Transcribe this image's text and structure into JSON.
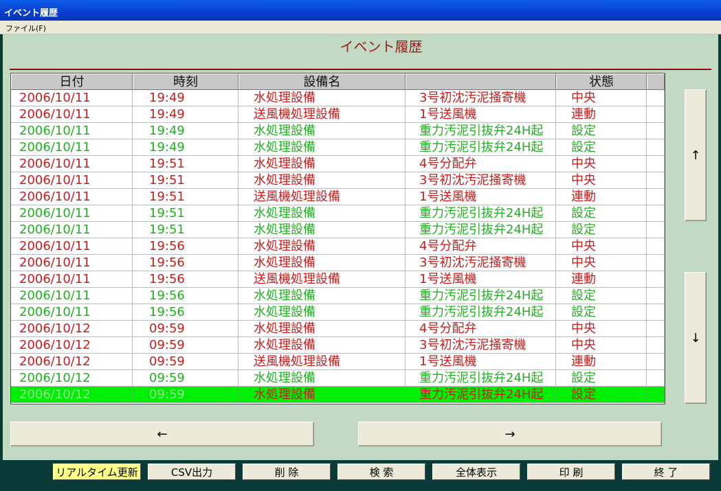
{
  "window": {
    "title": "イベント履歴"
  },
  "menu": {
    "file": "ファイル(F)"
  },
  "heading": "イベント履歴",
  "table": {
    "columns": [
      "日付",
      "時刻",
      "設備名",
      "",
      "状態",
      ""
    ],
    "rows": [
      {
        "date": "2006/10/11",
        "time": "19:49",
        "equip": "水処理設備",
        "point": "3号初沈汚泥掻寄機",
        "state": "中央",
        "color": "red"
      },
      {
        "date": "2006/10/11",
        "time": "19:49",
        "equip": "送風機処理設備",
        "point": "1号送風機",
        "state": "連動",
        "color": "red"
      },
      {
        "date": "2006/10/11",
        "time": "19:49",
        "equip": "水処理設備",
        "point": "重力汚泥引抜弁24H起",
        "state": "設定",
        "color": "green"
      },
      {
        "date": "2006/10/11",
        "time": "19:49",
        "equip": "水処理設備",
        "point": "重力汚泥引抜弁24H起",
        "state": "設定",
        "color": "green"
      },
      {
        "date": "2006/10/11",
        "time": "19:51",
        "equip": "水処理設備",
        "point": "4号分配弁",
        "state": "中央",
        "color": "red"
      },
      {
        "date": "2006/10/11",
        "time": "19:51",
        "equip": "水処理設備",
        "point": "3号初沈汚泥掻寄機",
        "state": "中央",
        "color": "red"
      },
      {
        "date": "2006/10/11",
        "time": "19:51",
        "equip": "送風機処理設備",
        "point": "1号送風機",
        "state": "連動",
        "color": "red"
      },
      {
        "date": "2006/10/11",
        "time": "19:51",
        "equip": "水処理設備",
        "point": "重力汚泥引抜弁24H起",
        "state": "設定",
        "color": "green"
      },
      {
        "date": "2006/10/11",
        "time": "19:51",
        "equip": "水処理設備",
        "point": "重力汚泥引抜弁24H起",
        "state": "設定",
        "color": "green"
      },
      {
        "date": "2006/10/11",
        "time": "19:56",
        "equip": "水処理設備",
        "point": "4号分配弁",
        "state": "中央",
        "color": "red"
      },
      {
        "date": "2006/10/11",
        "time": "19:56",
        "equip": "水処理設備",
        "point": "3号初沈汚泥掻寄機",
        "state": "中央",
        "color": "red"
      },
      {
        "date": "2006/10/11",
        "time": "19:56",
        "equip": "送風機処理設備",
        "point": "1号送風機",
        "state": "連動",
        "color": "red"
      },
      {
        "date": "2006/10/11",
        "time": "19:56",
        "equip": "水処理設備",
        "point": "重力汚泥引抜弁24H起",
        "state": "設定",
        "color": "green"
      },
      {
        "date": "2006/10/11",
        "time": "19:56",
        "equip": "水処理設備",
        "point": "重力汚泥引抜弁24H起",
        "state": "設定",
        "color": "green"
      },
      {
        "date": "2006/10/12",
        "time": "09:59",
        "equip": "水処理設備",
        "point": "4号分配弁",
        "state": "中央",
        "color": "red"
      },
      {
        "date": "2006/10/12",
        "time": "09:59",
        "equip": "水処理設備",
        "point": "3号初沈汚泥掻寄機",
        "state": "中央",
        "color": "red"
      },
      {
        "date": "2006/10/12",
        "time": "09:59",
        "equip": "送風機処理設備",
        "point": "1号送風機",
        "state": "連動",
        "color": "red"
      },
      {
        "date": "2006/10/12",
        "time": "09:59",
        "equip": "水処理設備",
        "point": "重力汚泥引抜弁24H起",
        "state": "設定",
        "color": "green"
      },
      {
        "date": "2006/10/12",
        "time": "09:59",
        "equip": "水処理設備",
        "point": "重力汚泥引抜弁24H起",
        "state": "設定",
        "color": "selected"
      }
    ]
  },
  "nav": {
    "up": "↑",
    "down": "↓",
    "left": "←",
    "right": "→"
  },
  "footer": {
    "realtime": "リアルタイム更新",
    "csv": "CSV出力",
    "delete": "削 除",
    "search": "検 索",
    "show_all": "全体表示",
    "print": "印 刷",
    "exit": "終 了"
  }
}
